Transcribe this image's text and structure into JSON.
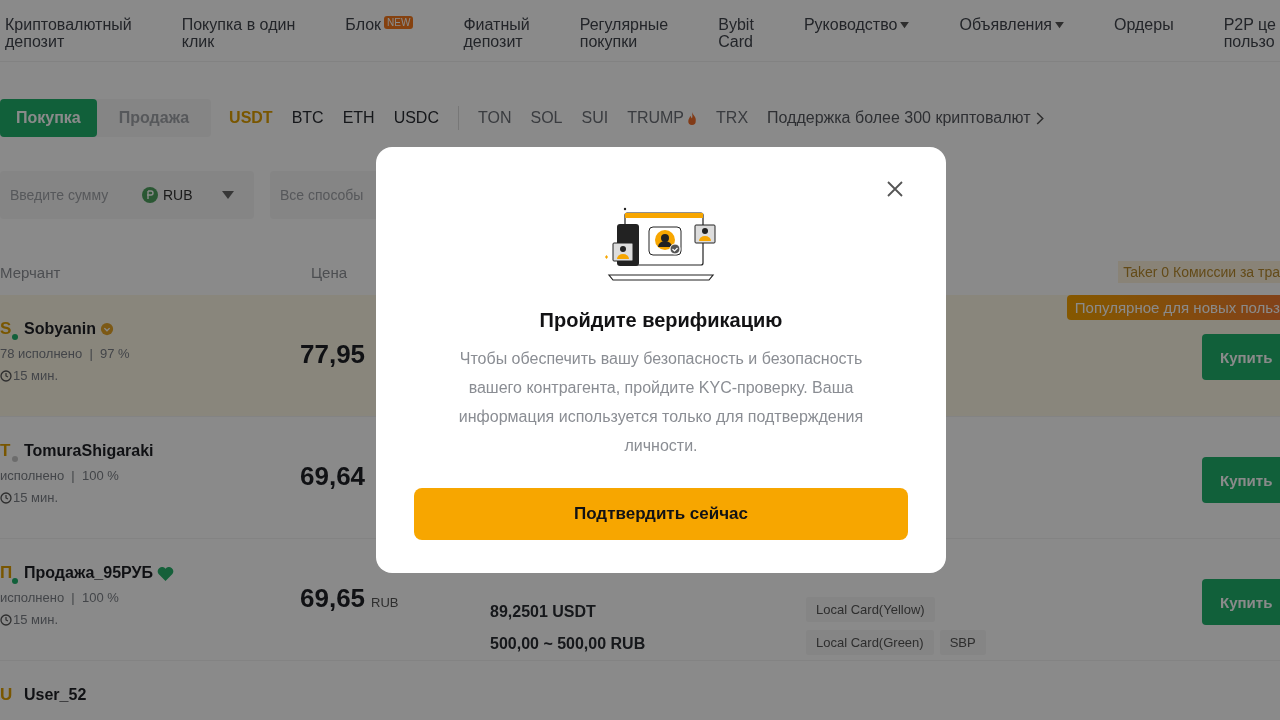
{
  "nav": {
    "items": [
      {
        "lines": [
          "Криптовалютный",
          "депозит"
        ],
        "dropdown": false
      },
      {
        "lines": [
          "Покупка в один",
          "клик"
        ],
        "dropdown": false
      },
      {
        "lines": [
          "Блок"
        ],
        "badge": "NEW",
        "dropdown": false
      },
      {
        "lines": [
          "Фиатный",
          "депозит"
        ],
        "dropdown": false
      },
      {
        "lines": [
          "Регулярные",
          "покупки"
        ],
        "dropdown": false
      },
      {
        "lines": [
          "Bybit",
          "Card"
        ],
        "dropdown": false
      },
      {
        "lines": [
          "Руководство"
        ],
        "dropdown": true
      },
      {
        "lines": [
          "Объявления"
        ],
        "dropdown": true
      },
      {
        "lines": [
          "Ордеры"
        ],
        "dropdown": false
      },
      {
        "lines": [
          "P2P це",
          "пользо"
        ],
        "dropdown": false
      }
    ]
  },
  "trade_tabs": [
    {
      "label": "Покупка",
      "selected": true
    },
    {
      "label": "Продажа",
      "selected": false
    }
  ],
  "coins": [
    {
      "label": "USDT",
      "kind": "main",
      "selected": true,
      "hot": false
    },
    {
      "label": "BTC",
      "kind": "main",
      "selected": false,
      "hot": false
    },
    {
      "label": "ETH",
      "kind": "main",
      "selected": false,
      "hot": false
    },
    {
      "label": "USDC",
      "kind": "main",
      "selected": false,
      "hot": false
    },
    {
      "label": "TON",
      "kind": "extra",
      "selected": false,
      "hot": false
    },
    {
      "label": "SOL",
      "kind": "extra",
      "selected": false,
      "hot": false
    },
    {
      "label": "SUI",
      "kind": "extra",
      "selected": false,
      "hot": false
    },
    {
      "label": "TRUMP",
      "kind": "extra",
      "selected": false,
      "hot": true
    },
    {
      "label": "TRX",
      "kind": "extra",
      "selected": false,
      "hot": false
    }
  ],
  "more_link": "Поддержка более 300 криптовалют",
  "filters": {
    "amount_placeholder": "Введите сумму",
    "currency": "RUB",
    "payment_placeholder": "Все способы"
  },
  "table": {
    "columns": [
      "Мерчант",
      "Цена"
    ],
    "taker_note": "Taker 0 Комиссии за тра",
    "rows": [
      {
        "avatar": "S",
        "name": "Sobyanin",
        "online": true,
        "verified": true,
        "favorite": false,
        "stats": "78 исполнено  |  97 %",
        "time": "15 мин.",
        "price": "77,95",
        "promoted": true,
        "promo_tag": "Популярное для новых польз",
        "action": "Купить"
      },
      {
        "avatar": "T",
        "name": "TomuraShigaraki",
        "online": false,
        "verified": false,
        "favorite": false,
        "stats": "исполнено  |  100 %",
        "time": "15 мин.",
        "price": "69,64",
        "promoted": false,
        "action": "Купить"
      },
      {
        "avatar": "П",
        "name": "Продажа_95РУБ",
        "online": true,
        "verified": false,
        "favorite": true,
        "stats": "исполнено  |  100 %",
        "time": "15 мин.",
        "price": "69,65",
        "unit": "RUB",
        "available": "89,2501 USDT",
        "limit": "500,00 ~ 500,00 RUB",
        "payments": [
          "Local Card(Yellow)",
          "Local Card(Green)",
          "SBP"
        ],
        "promoted": false,
        "action": "Купить"
      },
      {
        "avatar": "U",
        "name": "User_52",
        "promoted": false
      }
    ]
  },
  "modal": {
    "title": "Пройдите верификацию",
    "text": "Чтобы обеспечить вашу безопасность и безопасность вашего контрагента, пройдите KYC-проверку. Ваша информация используется только для подтверждения личности.",
    "button": "Подтвердить сейчас"
  }
}
